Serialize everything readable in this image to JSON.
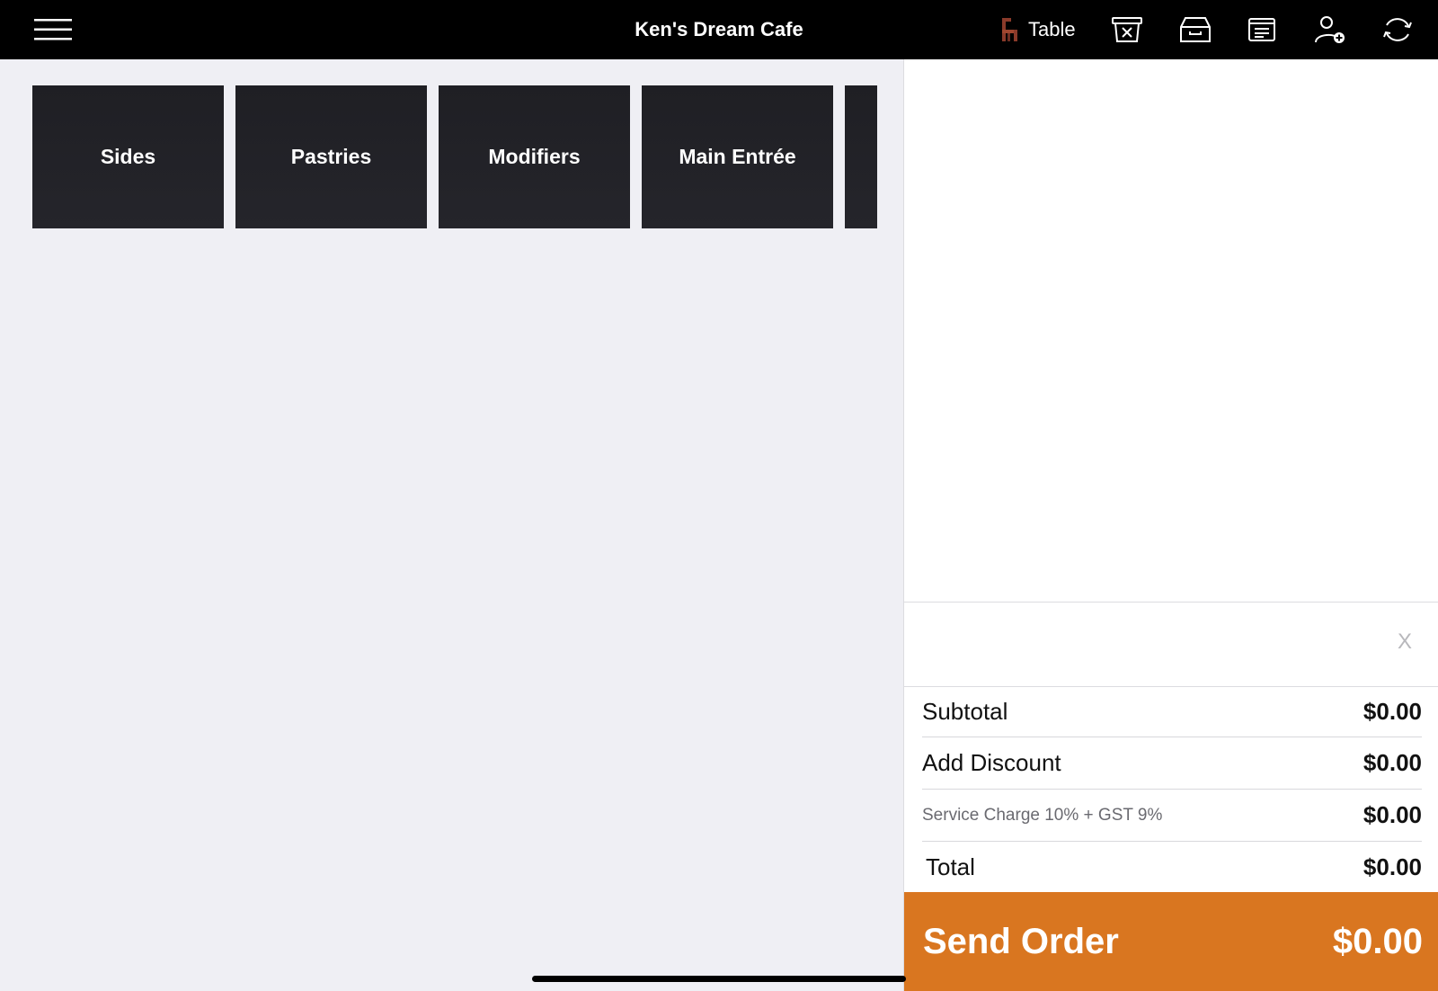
{
  "header": {
    "title": "Ken's Dream Cafe",
    "table_label": "Table"
  },
  "categories": [
    {
      "label": "Sides"
    },
    {
      "label": "Pastries"
    },
    {
      "label": "Modifiers"
    },
    {
      "label": "Main Entrée"
    }
  ],
  "note": {
    "clear_label": "X"
  },
  "summary": {
    "subtotal_label": "Subtotal",
    "subtotal_value": "$0.00",
    "discount_label": "Add Discount",
    "discount_value": "$0.00",
    "service_label": "Service Charge 10% + GST 9%",
    "service_value": "$0.00",
    "total_label": "Total",
    "total_value": "$0.00"
  },
  "send_order": {
    "label": "Send Order",
    "total": "$0.00"
  },
  "colors": {
    "accent": "#d97620",
    "topbar": "#000000",
    "tile": "#222227",
    "background": "#efeff4"
  }
}
